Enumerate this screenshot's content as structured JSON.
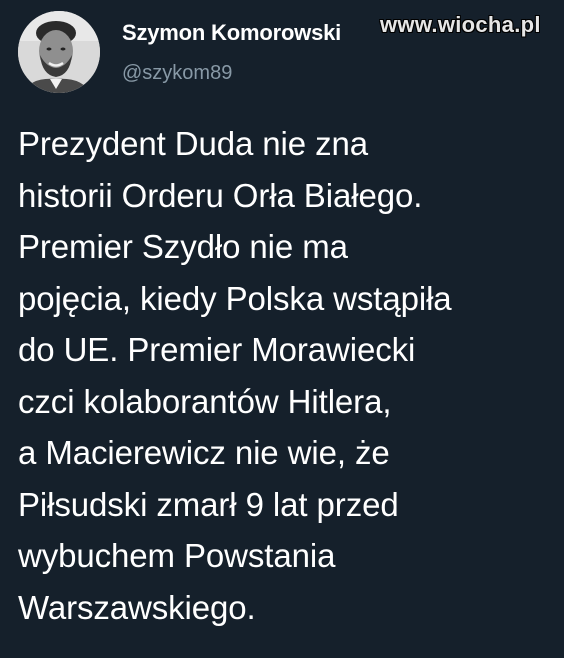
{
  "watermark": "www.wiocha.pl",
  "user": {
    "display_name": "Szymon Komorowski",
    "handle": "@szykom89"
  },
  "tweet": {
    "lines": [
      "Prezydent Duda nie zna",
      "historii Orderu Orła Białego.",
      "Premier Szydło nie ma",
      "pojęcia, kiedy Polska wstąpiła",
      "do UE. Premier Morawiecki",
      "czci kolaborantów Hitlera,",
      "a Macierewicz nie wie, że",
      "Piłsudski zmarł 9 lat przed",
      "wybuchem Powstania",
      "Warszawskiego."
    ]
  },
  "colors": {
    "background": "#15202b",
    "text": "#ffffff",
    "secondary_text": "#8899a6"
  }
}
